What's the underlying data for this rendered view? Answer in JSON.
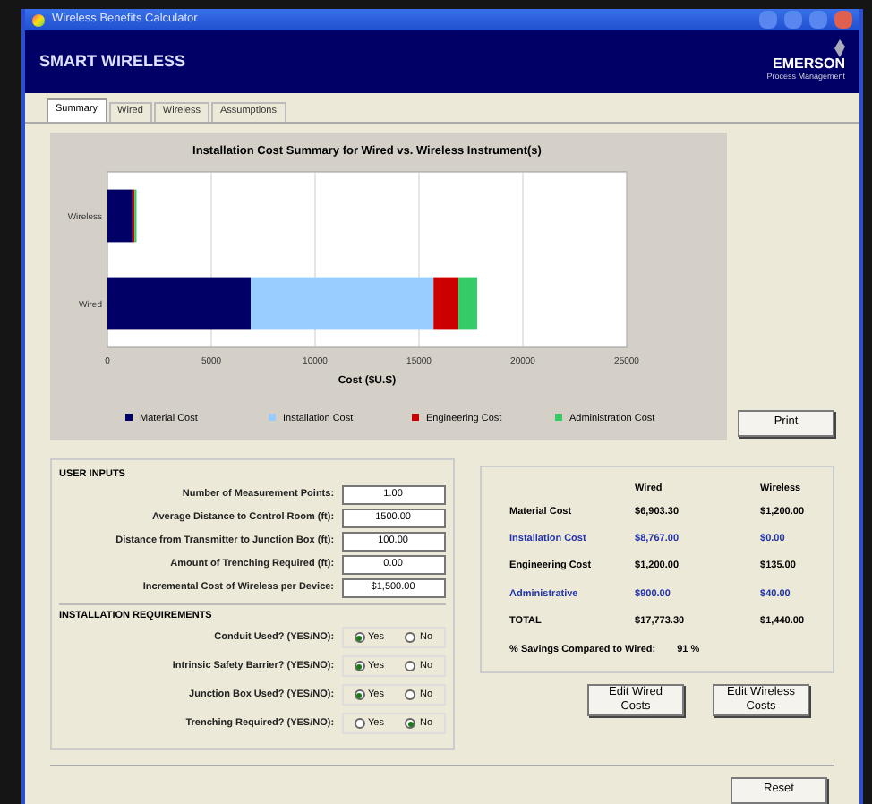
{
  "window": {
    "title": "Wireless Benefits Calculator"
  },
  "banner": {
    "title": "SMART WIRELESS",
    "brand": "EMERSON",
    "brand_sub": "Process Management"
  },
  "tabs": [
    {
      "label": "Summary",
      "selected": true
    },
    {
      "label": "Wired",
      "selected": false
    },
    {
      "label": "Wireless",
      "selected": false
    },
    {
      "label": "Assumptions",
      "selected": false
    }
  ],
  "chart": {
    "chart_data": {
      "type": "bar",
      "orientation": "horizontal",
      "stacked": true,
      "title": "Installation Cost Summary for Wired vs. Wireless Instrument(s)",
      "xlabel": "Cost ($U.S)",
      "categories": [
        "Wireless",
        "Wired"
      ],
      "xlim": [
        0,
        25000
      ],
      "grid": true,
      "legend": true,
      "xticks": [
        0,
        5000,
        10000,
        15000,
        20000,
        25000
      ],
      "series": [
        {
          "name": "Material Cost",
          "color": "#000066",
          "values": [
            1200,
            6900
          ]
        },
        {
          "name": "Installation Cost",
          "color": "#99ccff",
          "values": [
            0,
            8800
          ]
        },
        {
          "name": "Engineering Cost",
          "color": "#cc0000",
          "values": [
            100,
            1200
          ]
        },
        {
          "name": "Administration Cost",
          "color": "#33cc66",
          "values": [
            100,
            900
          ]
        }
      ]
    }
  },
  "print_button": "Print",
  "user_inputs": {
    "heading": "USER INPUTS",
    "fields": [
      {
        "label": "Number of Measurement Points:",
        "value": "1.00"
      },
      {
        "label": "Average Distance to Control Room (ft):",
        "value": "1500.00"
      },
      {
        "label": "Distance from Transmitter to Junction Box (ft):",
        "value": "100.00"
      },
      {
        "label": "Amount of Trenching Required (ft):",
        "value": "0.00"
      },
      {
        "label": "Incremental Cost of Wireless per Device:",
        "value": "$1,500.00"
      }
    ]
  },
  "installation_requirements": {
    "heading": "INSTALLATION REQUIREMENTS",
    "rows": [
      {
        "label": "Conduit Used? (YES/NO):",
        "options": [
          {
            "label": "Yes",
            "selected": true
          },
          {
            "label": "No",
            "selected": false
          }
        ]
      },
      {
        "label": "Intrinsic Safety Barrier? (YES/NO):",
        "options": [
          {
            "label": "Yes",
            "selected": true
          },
          {
            "label": "No",
            "selected": false
          }
        ]
      },
      {
        "label": "Junction Box Used? (YES/NO):",
        "options": [
          {
            "label": "Yes",
            "selected": true
          },
          {
            "label": "No",
            "selected": false
          }
        ]
      },
      {
        "label": "Trenching Required? (YES/NO):",
        "options": [
          {
            "label": "Yes",
            "selected": false
          },
          {
            "label": "No",
            "selected": true
          }
        ]
      }
    ]
  },
  "cost_table": {
    "columns": [
      "Wired",
      "Wireless"
    ],
    "rows": [
      {
        "label": "Material Cost",
        "wired": "$6,903.30",
        "wireless": "$1,200.00",
        "highlight": false
      },
      {
        "label": "Installation Cost",
        "wired": "$8,767.00",
        "wireless": "$0.00",
        "highlight": true
      },
      {
        "label": "Engineering Cost",
        "wired": "$1,200.00",
        "wireless": "$135.00",
        "highlight": false
      },
      {
        "label": "Administrative",
        "wired": "$900.00",
        "wireless": "$40.00",
        "highlight": true
      },
      {
        "label": "TOTAL",
        "wired": "$17,773.30",
        "wireless": "$1,440.00",
        "highlight": false
      }
    ],
    "savings_label": "% Savings Compared to Wired:",
    "savings_value": "91 %"
  },
  "buttons": [
    "Edit Wired Costs",
    "Edit Wireless Costs"
  ],
  "reset_button": "Reset"
}
